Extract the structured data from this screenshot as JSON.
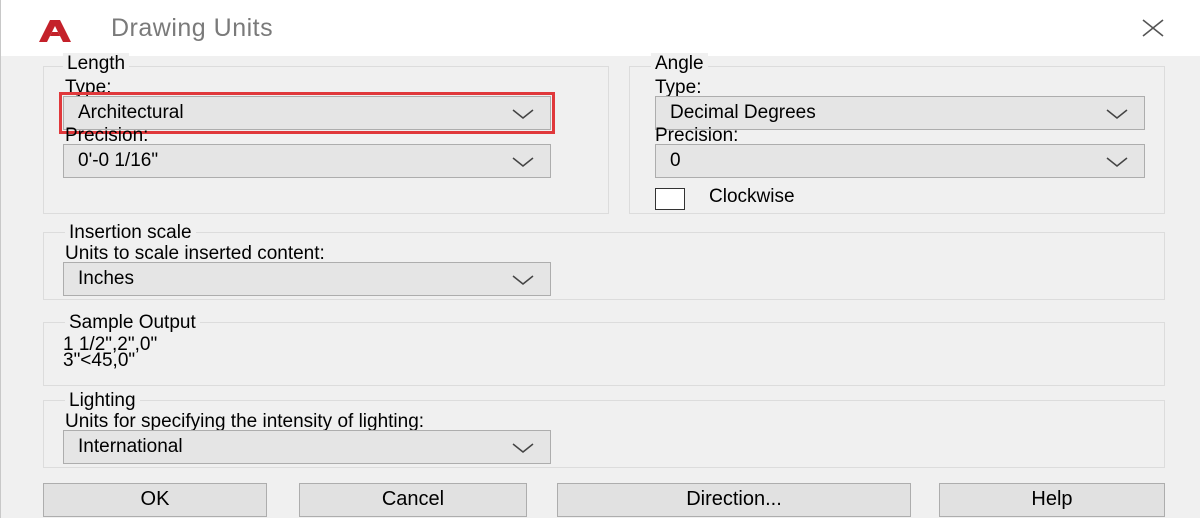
{
  "window": {
    "title": "Drawing Units",
    "icon": "autocad-a-logo-icon",
    "accent": "#c4212a"
  },
  "length": {
    "group_label": "Length",
    "type_label": "Type:",
    "type_value": "Architectural",
    "precision_label": "Precision:",
    "precision_value": "0'-0 1/16\""
  },
  "angle": {
    "group_label": "Angle",
    "type_label": "Type:",
    "type_value": "Decimal Degrees",
    "precision_label": "Precision:",
    "precision_value": "0",
    "clockwise_label": "Clockwise",
    "clockwise_checked": false
  },
  "insertion": {
    "group_label": "Insertion scale",
    "units_label": "Units to scale inserted content:",
    "units_value": "Inches"
  },
  "sample": {
    "group_label": "Sample Output",
    "line1": "1 1/2\",2\",0\"",
    "line2": "3\"<45,0\""
  },
  "lighting": {
    "group_label": "Lighting",
    "units_label": "Units for specifying the intensity of lighting:",
    "units_value": "International"
  },
  "buttons": {
    "ok": "OK",
    "cancel": "Cancel",
    "direction": "Direction...",
    "help": "Help"
  },
  "highlight_color": "#e0383b"
}
